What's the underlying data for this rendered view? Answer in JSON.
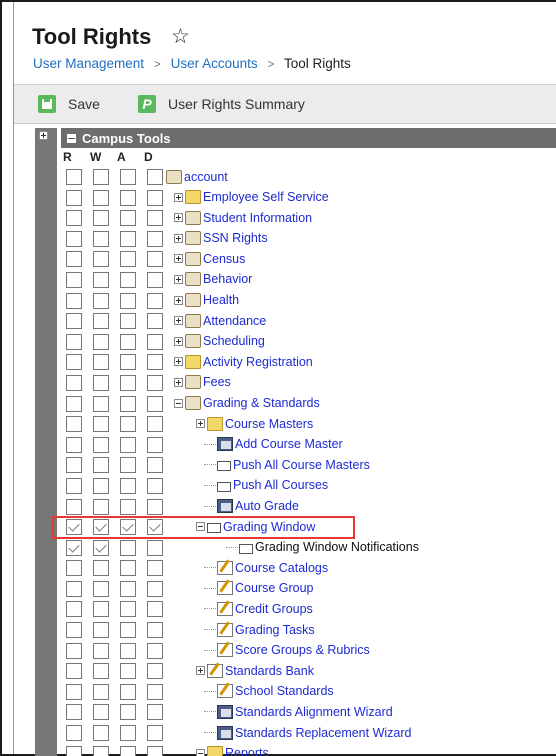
{
  "header": {
    "title": "Tool Rights",
    "breadcrumb": [
      "User Management",
      "User Accounts",
      "Tool Rights"
    ]
  },
  "toolbar": {
    "save_label": "Save",
    "summary_label": "User Rights Summary"
  },
  "tree": {
    "header_label": "Campus Tools",
    "col_heads": [
      "R",
      "W",
      "A",
      "D"
    ],
    "rows": [
      {
        "label": "account",
        "checks": [
          0,
          0,
          0,
          0
        ],
        "icon": "account-icon"
      },
      {
        "label": "Employee Self Service",
        "checks": [
          0,
          0,
          0,
          0
        ],
        "icon": "folder-icon"
      },
      {
        "label": "Student Information",
        "checks": [
          0,
          0,
          0,
          0
        ],
        "icon": "student-icon"
      },
      {
        "label": "SSN Rights",
        "checks": [
          0,
          0,
          0,
          0
        ],
        "icon": "lock-icon"
      },
      {
        "label": "Census",
        "checks": [
          0,
          0,
          0,
          0
        ],
        "icon": "census-icon"
      },
      {
        "label": "Behavior",
        "checks": [
          0,
          0,
          0,
          0
        ],
        "icon": "behavior-icon"
      },
      {
        "label": "Health",
        "checks": [
          0,
          0,
          0,
          0
        ],
        "icon": "health-icon"
      },
      {
        "label": "Attendance",
        "checks": [
          0,
          0,
          0,
          0
        ],
        "icon": "attendance-icon"
      },
      {
        "label": "Scheduling",
        "checks": [
          0,
          0,
          0,
          0
        ],
        "icon": "scheduling-icon"
      },
      {
        "label": "Activity Registration",
        "checks": [
          0,
          0,
          0,
          0
        ],
        "icon": "folder-icon"
      },
      {
        "label": "Fees",
        "checks": [
          0,
          0,
          0,
          0
        ],
        "icon": "dollar-icon"
      },
      {
        "label": "Grading & Standards",
        "checks": [
          0,
          0,
          0,
          0
        ],
        "icon": "grading-icon"
      },
      {
        "label": "Course Masters",
        "checks": [
          0,
          0,
          0,
          0
        ],
        "icon": "folder-icon"
      },
      {
        "label": "Add Course Master",
        "checks": [
          0,
          0,
          0,
          0
        ],
        "icon": "stack-icon"
      },
      {
        "label": "Push All Course Masters",
        "checks": [
          0,
          0,
          0,
          0
        ],
        "icon": "page-icon"
      },
      {
        "label": "Push All Courses",
        "checks": [
          0,
          0,
          0,
          0
        ],
        "icon": "page-icon"
      },
      {
        "label": "Auto Grade",
        "checks": [
          0,
          0,
          0,
          0
        ],
        "icon": "stack-icon"
      },
      {
        "label": "Grading Window",
        "checks": [
          1,
          1,
          1,
          1
        ],
        "icon": "page-icon"
      },
      {
        "label": "Grading Window Notifications",
        "checks": [
          1,
          1,
          0,
          0
        ],
        "icon": "page-icon"
      },
      {
        "label": "Course Catalogs",
        "checks": [
          0,
          0,
          0,
          0
        ],
        "icon": "edit-icon"
      },
      {
        "label": "Course Group",
        "checks": [
          0,
          0,
          0,
          0
        ],
        "icon": "edit-icon"
      },
      {
        "label": "Credit Groups",
        "checks": [
          0,
          0,
          0,
          0
        ],
        "icon": "edit-icon"
      },
      {
        "label": "Grading Tasks",
        "checks": [
          0,
          0,
          0,
          0
        ],
        "icon": "edit-icon"
      },
      {
        "label": "Score Groups & Rubrics",
        "checks": [
          0,
          0,
          0,
          0
        ],
        "icon": "edit-icon"
      },
      {
        "label": "Standards Bank",
        "checks": [
          0,
          0,
          0,
          0
        ],
        "icon": "edit-icon"
      },
      {
        "label": "School Standards",
        "checks": [
          0,
          0,
          0,
          0
        ],
        "icon": "edit-icon"
      },
      {
        "label": "Standards Alignment Wizard",
        "checks": [
          0,
          0,
          0,
          0
        ],
        "icon": "stack-icon"
      },
      {
        "label": "Standards Replacement Wizard",
        "checks": [
          0,
          0,
          0,
          0
        ],
        "icon": "stack-icon"
      },
      {
        "label": "Reports",
        "checks": [
          0,
          0,
          0,
          0
        ],
        "icon": "folder-icon"
      }
    ]
  }
}
